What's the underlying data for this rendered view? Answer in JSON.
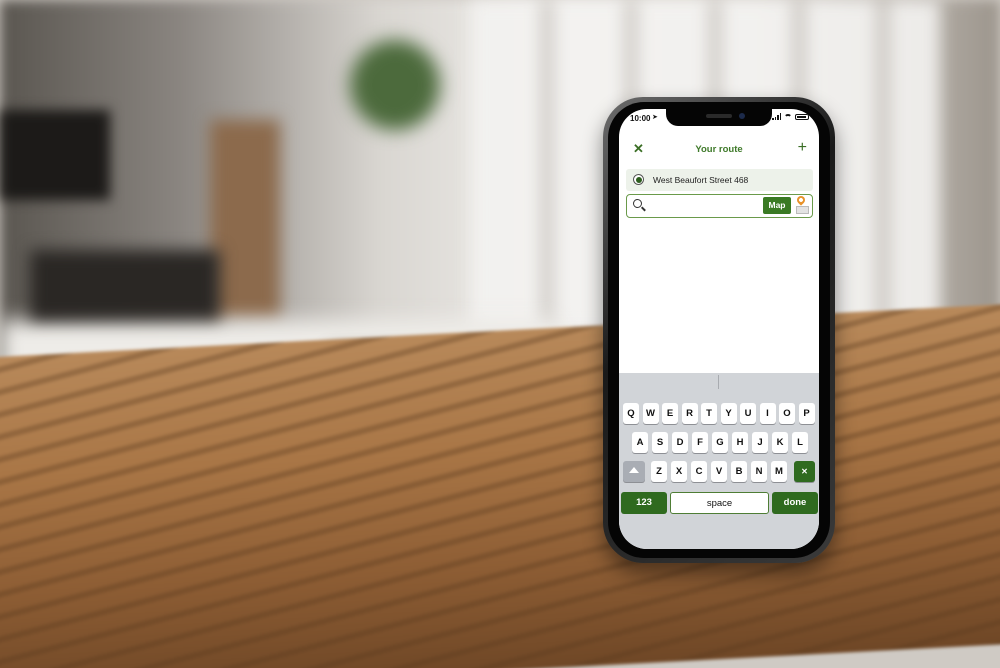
{
  "status_bar": {
    "time": "10:00",
    "location_glyph": "➤"
  },
  "header": {
    "close_glyph": "✕",
    "title": "Your route",
    "add_glyph": "+"
  },
  "route": {
    "start_address": "West Beaufort Street 468",
    "search_placeholder": "",
    "map_button": "Map"
  },
  "keyboard": {
    "row1": [
      "Q",
      "W",
      "E",
      "R",
      "T",
      "Y",
      "U",
      "I",
      "O",
      "P"
    ],
    "row2": [
      "A",
      "S",
      "D",
      "F",
      "G",
      "H",
      "J",
      "K",
      "L"
    ],
    "row3": [
      "Z",
      "X",
      "C",
      "V",
      "B",
      "N",
      "M"
    ],
    "delete_glyph": "✕",
    "numbers_label": "123",
    "space_label": "space",
    "done_label": "done"
  },
  "colors": {
    "brand_green": "#3a7a24",
    "pin_orange": "#e8922a"
  }
}
